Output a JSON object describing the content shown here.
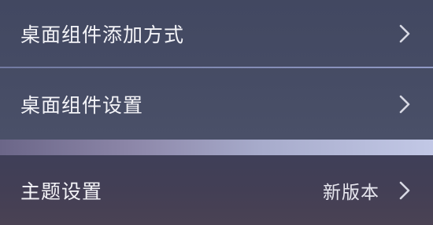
{
  "settings": {
    "widget_add_method": {
      "label": "桌面组件添加方式"
    },
    "widget_settings": {
      "label": "桌面组件设置"
    },
    "theme_settings": {
      "label": "主题设置",
      "value": "新版本"
    }
  },
  "icons": {
    "chevron": "chevron-right-icon"
  },
  "colors": {
    "card_background": "#454b64",
    "divider": "#9aa4d8",
    "text": "#f4f4f8"
  }
}
